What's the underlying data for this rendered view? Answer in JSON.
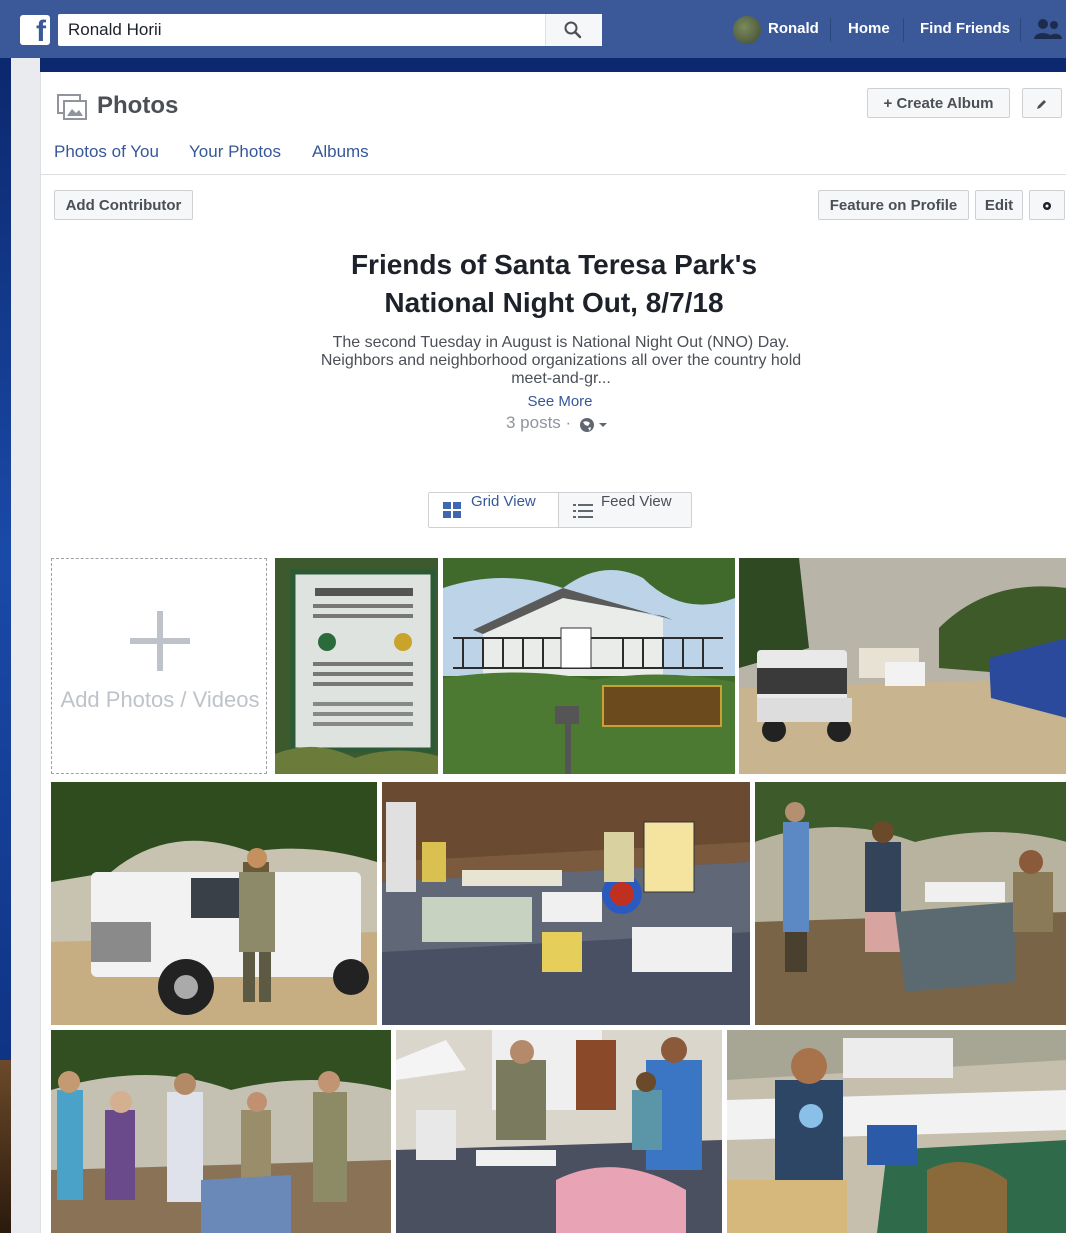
{
  "search": {
    "value": "Ronald Horii"
  },
  "nav": {
    "profile": "Ronald",
    "home": "Home",
    "find_friends": "Find Friends"
  },
  "header": {
    "title": "Photos",
    "create_album": "+ Create Album"
  },
  "tabs": [
    "Photos of You",
    "Your Photos",
    "Albums"
  ],
  "toolbar": {
    "add_contributor": "Add Contributor",
    "feature_on_profile": "Feature on Profile",
    "edit": "Edit"
  },
  "album": {
    "title_line1": "Friends of Santa Teresa Park's",
    "title_line2": "National Night Out, 8/7/18",
    "description": "The second Tuesday in August is National Night Out (NNO) Day. Neighbors and neighborhood organizations all over the country hold meet-and-gr...",
    "see_more": "See More",
    "posts": "3 posts ·"
  },
  "view": {
    "grid": "Grid View",
    "feed": "Feed View"
  },
  "add_photos": "Add Photos / Videos"
}
